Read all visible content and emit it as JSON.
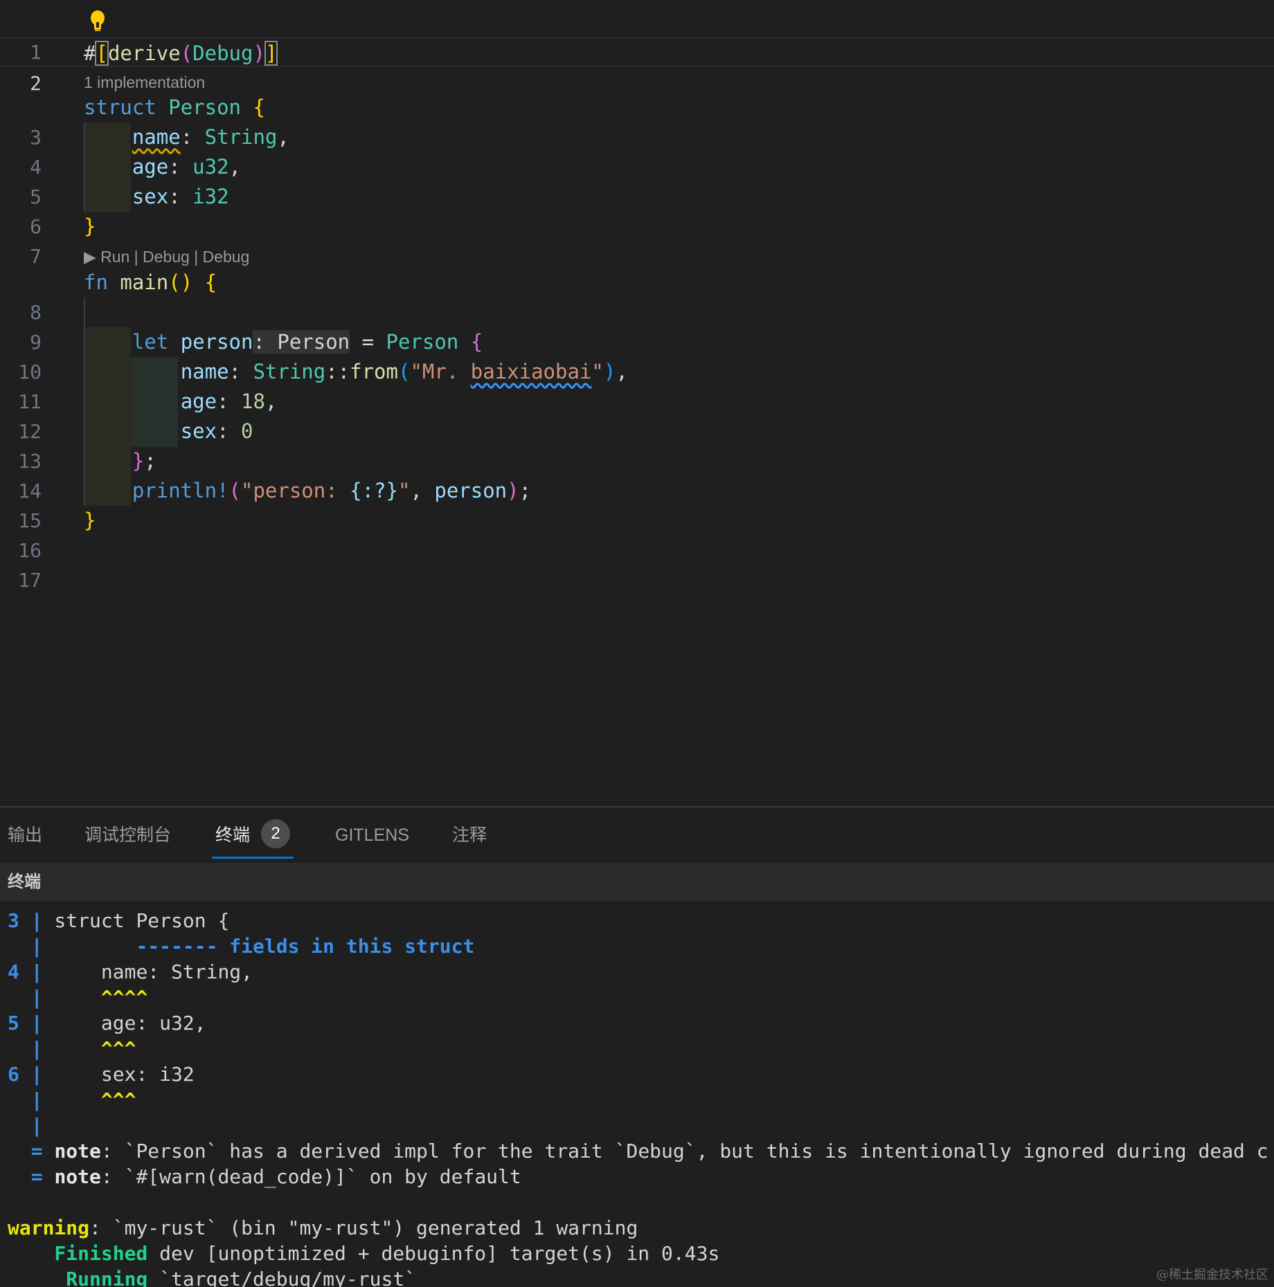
{
  "editor": {
    "line_numbers": [
      "1",
      "2",
      "3",
      "4",
      "5",
      "6",
      "7",
      "8",
      "9",
      "10",
      "11",
      "12",
      "13",
      "14",
      "15",
      "16",
      "17"
    ],
    "code_lens_impl": "1 implementation",
    "code_lens_run": "▶ Run | Debug | Debug",
    "tokens": {
      "l2_hash": "#",
      "l2_open": "[",
      "l2_derive": "derive",
      "l2_paren_open": "(",
      "l2_debug": "Debug",
      "l2_paren_close": ")",
      "l2_close": "]",
      "l3_struct": "struct",
      "l3_name": "Person",
      "l3_brace": "{",
      "l4_field": "name",
      "l4_colon": ": ",
      "l4_type": "String",
      "l4_comma": ",",
      "l5_field": "age",
      "l5_colon": ": ",
      "l5_type": "u32",
      "l5_comma": ",",
      "l6_field": "sex",
      "l6_colon": ": ",
      "l6_type": "i32",
      "l7_brace": "}",
      "l8_fn": "fn",
      "l8_main": "main",
      "l8_parens": "()",
      "l8_brace": "{",
      "l10_let": "let",
      "l10_var": "person",
      "l10_hint": ": Person",
      "l10_eq": " = ",
      "l10_type": "Person",
      "l10_brace": "{",
      "l11_field": "name",
      "l11_colon": ": ",
      "l11_type": "String",
      "l11_path": "::",
      "l11_from": "from",
      "l11_paren": "(",
      "l11_str_a": "\"Mr. ",
      "l11_str_b": "baixiaobai",
      "l11_str_c": "\"",
      "l11_paren_close": ")",
      "l11_comma": ",",
      "l12_field": "age",
      "l12_colon": ": ",
      "l12_val": "18",
      "l12_comma": ",",
      "l13_field": "sex",
      "l13_colon": ": ",
      "l13_val": "0",
      "l14_brace": "}",
      "l14_semi": ";",
      "l15_macro": "println!",
      "l15_paren": "(",
      "l15_str_a": "\"person: ",
      "l15_fmt": "{:?}",
      "l15_str_b": "\"",
      "l15_comma": ", ",
      "l15_var": "person",
      "l15_paren_close": ")",
      "l15_semi": ";",
      "l16_brace": "}"
    }
  },
  "panel": {
    "tabs": [
      {
        "label": "输出"
      },
      {
        "label": "调试控制台"
      },
      {
        "label": "终端",
        "badge": "2"
      },
      {
        "label": "GITLENS"
      },
      {
        "label": "注释"
      }
    ],
    "active_tab": "终端",
    "terminal_title": "终端"
  },
  "terminal": {
    "lines": {
      "t1_num": "3 |",
      "t1_text": " struct Person {",
      "t2_bar": "  |",
      "t2_marker": "        ------- fields in this struct",
      "t3_num": "4 |",
      "t3_text": "     name: String,",
      "t4_bar": "  |",
      "t4_marker": "     ^^^^",
      "t5_num": "5 |",
      "t5_text": "     age: u32,",
      "t6_bar": "  |",
      "t6_marker": "     ^^^",
      "t7_num": "6 |",
      "t7_text": "     sex: i32",
      "t8_bar": "  |",
      "t8_marker": "     ^^^",
      "t9_bar": "  |",
      "t10_eq": "  = ",
      "t10_note": "note",
      "t10_text": ": `Person` has a derived impl for the trait `Debug`, but this is intentionally ignored during dead c",
      "t11_eq": "  = ",
      "t11_note": "note",
      "t11_text": ": `#[warn(dead_code)]` on by default",
      "t13_warning": "warning",
      "t13_text": ": `my-rust` (bin \"my-rust\") generated 1 warning",
      "t14_finished": "    Finished",
      "t14_text": " dev [unoptimized + debuginfo] target(s) in 0.43s",
      "t15_running": "     Running",
      "t15_text": " `target/debug/my-rust`"
    }
  },
  "watermark": "@稀土掘金技术社区",
  "colors": {
    "keyword": "#569cd6",
    "type": "#4ec9b0",
    "function": "#dcdcaa",
    "variable": "#9cdcfe",
    "string": "#ce9178",
    "number": "#b5cea8",
    "bracket_gold": "#ffd700",
    "bracket_purple": "#da70d6",
    "terminal_blue": "#3b8eea",
    "terminal_yellow": "#e5e510",
    "terminal_green": "#23d18b"
  }
}
